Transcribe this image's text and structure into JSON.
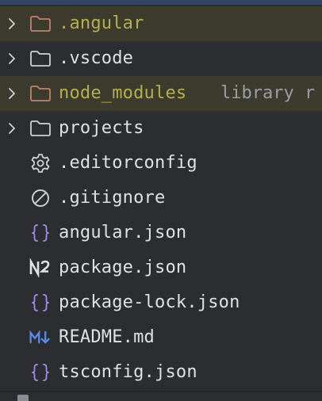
{
  "colors": {
    "background": "#2b2d30",
    "excluded_row": "#3d3a2e",
    "excluded_text": "#b4b04f",
    "text": "#dfe1e5",
    "folder_excluded": "#c4826a",
    "folder": "#cfd1d6",
    "json_braces": "#9b87e6",
    "markdown": "#5a8de8"
  },
  "items": [
    {
      "label": ".angular",
      "icon": "folder-icon",
      "expandable": true,
      "excluded": true
    },
    {
      "label": ".vscode",
      "icon": "folder-icon",
      "expandable": true,
      "excluded": false
    },
    {
      "label": "node_modules",
      "suffix": "library r",
      "icon": "folder-icon",
      "expandable": true,
      "excluded": true
    },
    {
      "label": "projects",
      "icon": "folder-icon",
      "expandable": true,
      "excluded": false
    },
    {
      "label": ".editorconfig",
      "icon": "gear-icon",
      "expandable": false
    },
    {
      "label": ".gitignore",
      "icon": "ignore-icon",
      "expandable": false
    },
    {
      "label": "angular.json",
      "icon": "json-icon",
      "expandable": false
    },
    {
      "label": "package.json",
      "icon": "npm-icon",
      "expandable": false
    },
    {
      "label": "package-lock.json",
      "icon": "json-icon",
      "expandable": false
    },
    {
      "label": "README.md",
      "icon": "markdown-icon",
      "expandable": false
    },
    {
      "label": "tsconfig.json",
      "icon": "json-icon",
      "expandable": false
    }
  ]
}
